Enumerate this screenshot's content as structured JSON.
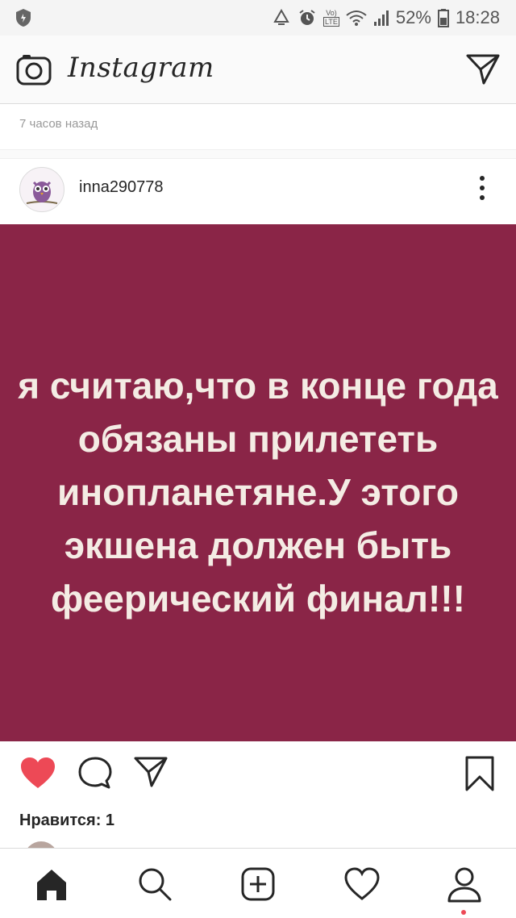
{
  "status_bar": {
    "battery_percent": "52%",
    "time": "18:28",
    "network_label": "LTE",
    "network_prefix": "Vo)",
    "icons": [
      "shield-icon",
      "recycle-icon",
      "alarm-icon",
      "wifi-icon",
      "signal-icon",
      "battery-icon"
    ]
  },
  "header": {
    "logo_text": "Instagram",
    "icons": [
      "camera-icon",
      "direct-message-icon"
    ]
  },
  "previous_post": {
    "time_ago": "7 часов назад"
  },
  "post": {
    "username": "inna290778",
    "image_text": "я считаю,что в конце года обязаны прилететь инопланетяне.У этого экшена должен быть феерический финал!!!",
    "image_background": "#8a2547",
    "image_text_color": "#f4ece4",
    "liked": true,
    "likes_text": "Нравится: 1"
  },
  "colors": {
    "like_red": "#ed4956",
    "text_primary": "#262626",
    "text_secondary": "#999999",
    "border": "#dbdbdb"
  },
  "bottom_nav": {
    "items": [
      "home-icon",
      "search-icon",
      "new-post-icon",
      "activity-heart-icon",
      "profile-icon"
    ]
  }
}
